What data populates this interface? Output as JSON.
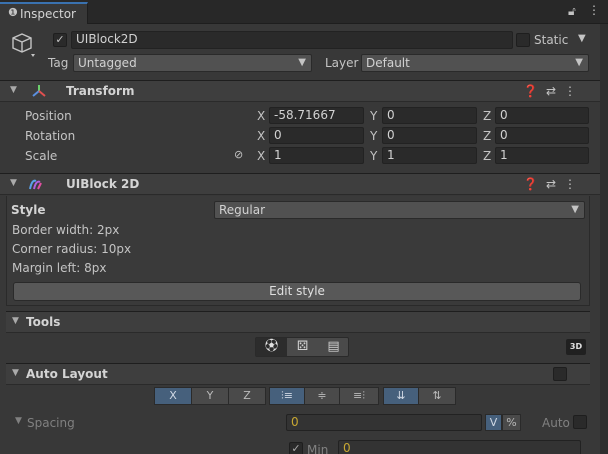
{
  "tab": {
    "title": "Inspector"
  },
  "object": {
    "name": "UIBlock2D",
    "static_label": "Static",
    "tag_label": "Tag",
    "tag_value": "Untagged",
    "layer_label": "Layer",
    "layer_value": "Default"
  },
  "transform": {
    "title": "Transform",
    "rows": [
      {
        "label": "Position",
        "x": "-58.71667",
        "y": "0",
        "z": "0"
      },
      {
        "label": "Rotation",
        "x": "0",
        "y": "0",
        "z": "0"
      },
      {
        "label": "Scale",
        "x": "1",
        "y": "1",
        "z": "1"
      }
    ],
    "axes": {
      "x": "X",
      "y": "Y",
      "z": "Z"
    }
  },
  "uiblock": {
    "title": "UIBlock 2D",
    "style_label": "Style",
    "style_value": "Regular",
    "info": [
      "Border width: 2px",
      "Corner radius: 10px",
      "Margin left: 8px"
    ],
    "edit_button": "Edit style"
  },
  "tools": {
    "title": "Tools",
    "badge": "3D"
  },
  "auto_layout": {
    "title": "Auto Layout",
    "axes": [
      "X",
      "Y",
      "Z"
    ],
    "spacing_label": "Spacing",
    "spacing_value": "0",
    "unit_v": "V",
    "unit_pct": "%",
    "auto_label": "Auto",
    "min_label": "Min",
    "min_value": "0"
  },
  "colors": {
    "accent": "#3a72b0",
    "panel": "#383838",
    "field": "#2a2a2a",
    "seg_on": "#46607c",
    "spacing_value": "#c8a832"
  }
}
